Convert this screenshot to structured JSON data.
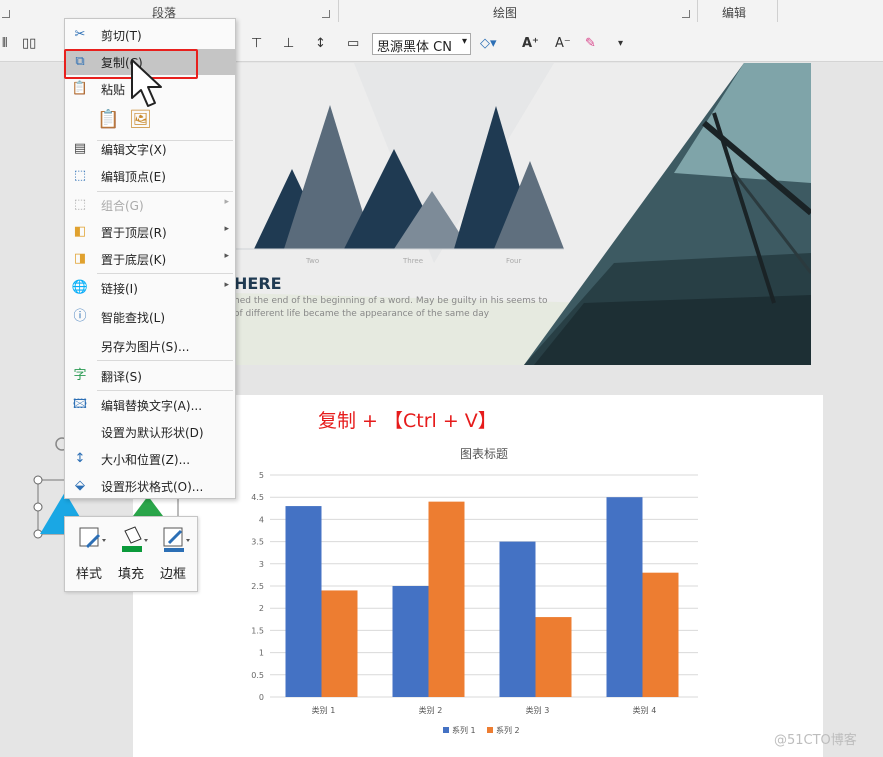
{
  "ribbon": {
    "groups": [
      "段落",
      "绘图",
      "编辑"
    ],
    "font_select": "思源黑体 CN"
  },
  "context_menu": {
    "items": [
      {
        "label": "剪切(T)",
        "icon": "scissors-icon"
      },
      {
        "label": "复制(C)",
        "icon": "copy-icon"
      },
      {
        "label": "粘贴",
        "icon": "paste-icon"
      },
      {
        "label": "编辑文字(X)",
        "icon": "edit-text-icon"
      },
      {
        "label": "编辑顶点(E)",
        "icon": "edit-points-icon"
      },
      {
        "label": "组合(G)",
        "icon": "group-icon"
      },
      {
        "label": "置于顶层(R)",
        "icon": "bring-to-front-icon"
      },
      {
        "label": "置于底层(K)",
        "icon": "send-to-back-icon"
      },
      {
        "label": "链接(I)",
        "icon": "link-icon"
      },
      {
        "label": "智能查找(L)",
        "icon": "smart-lookup-icon"
      },
      {
        "label": "另存为图片(S)...",
        "icon": ""
      },
      {
        "label": "翻译(S)",
        "icon": "translate-icon"
      },
      {
        "label": "编辑替换文字(A)...",
        "icon": "alt-text-icon"
      },
      {
        "label": "设置为默认形状(D)",
        "icon": ""
      },
      {
        "label": "大小和位置(Z)...",
        "icon": "size-position-icon"
      },
      {
        "label": "设置形状格式(O)...",
        "icon": "format-shape-icon"
      }
    ]
  },
  "mini_toolbar": {
    "buttons": [
      {
        "label": "样式",
        "icon": "style-icon"
      },
      {
        "label": "填充",
        "icon": "fill-bucket-icon"
      },
      {
        "label": "边框",
        "icon": "border-pen-icon"
      }
    ]
  },
  "slide1": {
    "heading": "HERE",
    "body_line1": "hed the end of the beginning of a word. May be guilty in his seems to",
    "body_line2": "of different life became the appearance of the same day",
    "small_labels": [
      "Two",
      "Three",
      "Four"
    ]
  },
  "hint": "复制 + 【Ctrl + V】",
  "watermark": "@51CTO博客",
  "chart_data": {
    "type": "bar",
    "title": "图表标题",
    "categories": [
      "类别 1",
      "类别 2",
      "类别 3",
      "类别 4"
    ],
    "series": [
      {
        "name": "系列 1",
        "values": [
          4.3,
          2.5,
          3.5,
          4.5
        ],
        "color": "#4472c4"
      },
      {
        "name": "系列 2",
        "values": [
          2.4,
          4.4,
          1.8,
          2.8
        ],
        "color": "#ed7d31"
      }
    ],
    "yticks": [
      "0",
      "0.5",
      "1",
      "1.5",
      "2",
      "2.5",
      "3",
      "3.5",
      "4",
      "4.5",
      "5"
    ],
    "ylim": [
      0,
      5
    ],
    "grid": true,
    "legend": "bottom"
  }
}
